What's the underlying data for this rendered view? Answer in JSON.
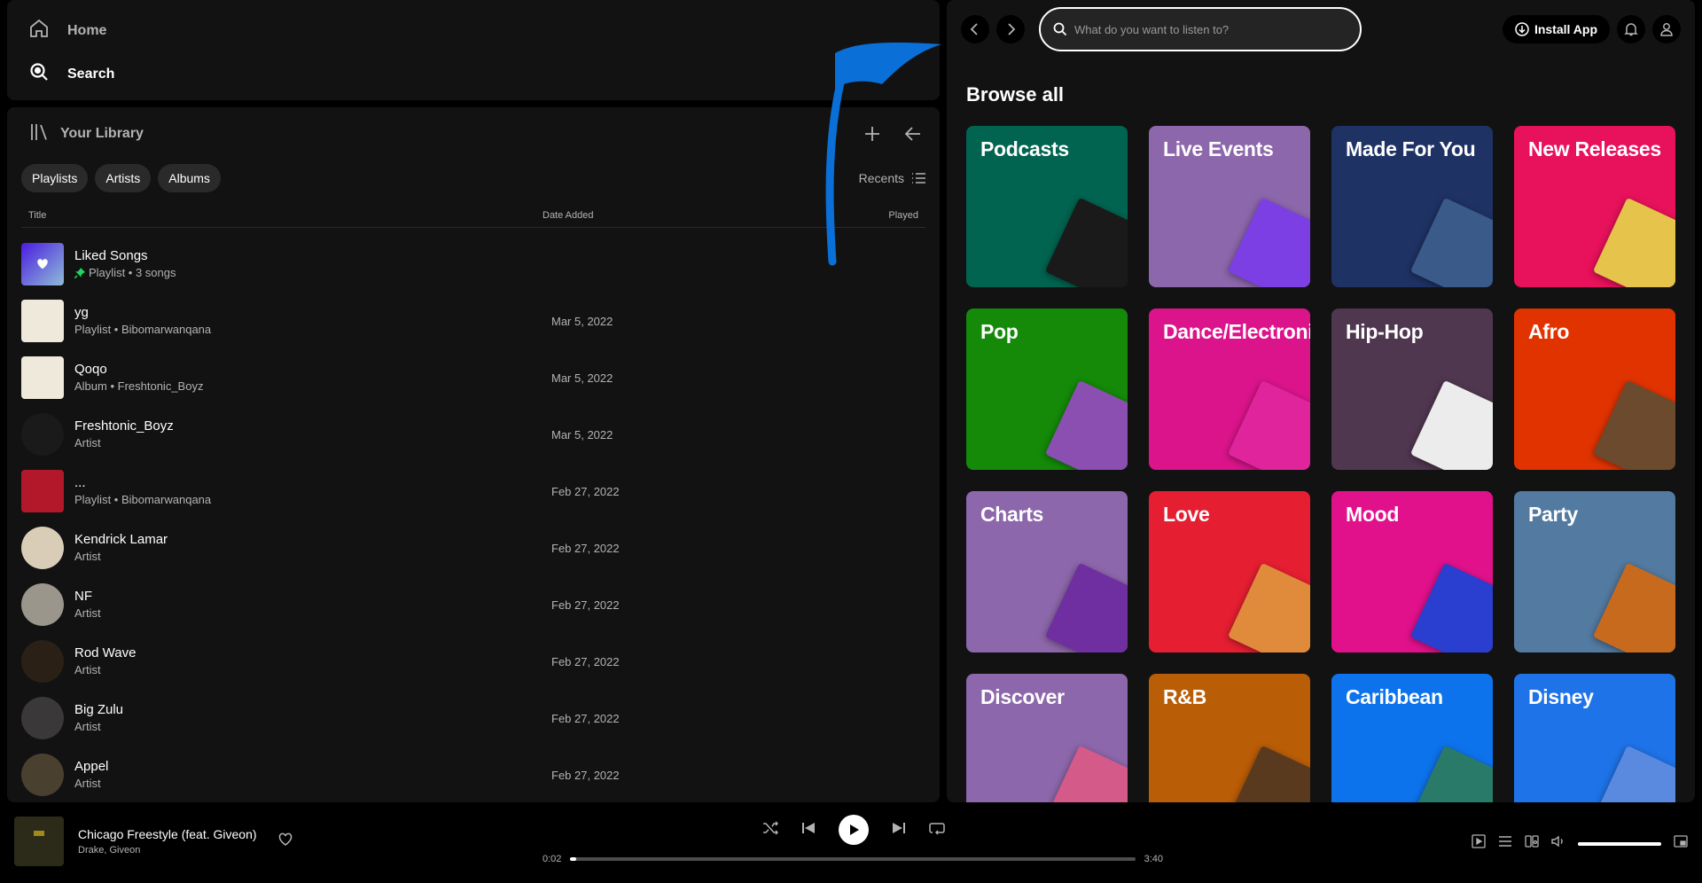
{
  "nav": {
    "home": "Home",
    "search": "Search"
  },
  "library": {
    "title": "Your Library",
    "chips": [
      "Playlists",
      "Artists",
      "Albums"
    ],
    "sort_label": "Recents",
    "columns": {
      "title": "Title",
      "date_added": "Date Added",
      "played": "Played"
    },
    "items": [
      {
        "title": "Liked Songs",
        "subtitle": "Playlist • 3 songs",
        "date": "",
        "pinned": true
      },
      {
        "title": "yg",
        "subtitle": "Playlist • Bibomarwanqana",
        "date": "Mar 5, 2022"
      },
      {
        "title": "Qoqo",
        "subtitle": "Album • Freshtonic_Boyz",
        "date": "Mar 5, 2022"
      },
      {
        "title": "Freshtonic_Boyz",
        "subtitle": "Artist",
        "date": "Mar 5, 2022"
      },
      {
        "title": "...",
        "subtitle": "Playlist • Bibomarwanqana",
        "date": "Feb 27, 2022"
      },
      {
        "title": "Kendrick Lamar",
        "subtitle": "Artist",
        "date": "Feb 27, 2022"
      },
      {
        "title": "NF",
        "subtitle": "Artist",
        "date": "Feb 27, 2022"
      },
      {
        "title": "Rod Wave",
        "subtitle": "Artist",
        "date": "Feb 27, 2022"
      },
      {
        "title": "Big Zulu",
        "subtitle": "Artist",
        "date": "Feb 27, 2022"
      },
      {
        "title": "Appel",
        "subtitle": "Artist",
        "date": "Feb 27, 2022"
      }
    ]
  },
  "topbar": {
    "search_placeholder": "What do you want to listen to?",
    "install_label": "Install App"
  },
  "browse": {
    "title": "Browse all",
    "cards": [
      {
        "title": "Podcasts",
        "color": "#006450",
        "art": "#1a1a1a"
      },
      {
        "title": "Live Events",
        "color": "#8d67ab",
        "art": "#7b3fe4"
      },
      {
        "title": "Made For You",
        "color": "#1e3264",
        "art": "#3a5a8a"
      },
      {
        "title": "New Releases",
        "color": "#e8115b",
        "art": "#e6c34a"
      },
      {
        "title": "Pop",
        "color": "#148a08",
        "art": "#8a4fb0"
      },
      {
        "title": "Dance/Electronic",
        "color": "#dc148c",
        "art": "#e0249c"
      },
      {
        "title": "Hip-Hop",
        "color": "#503750",
        "art": "#ececec"
      },
      {
        "title": "Afro",
        "color": "#e13300",
        "art": "#6b4a2e"
      },
      {
        "title": "Charts",
        "color": "#8d67ab",
        "art": "#6f2fa0"
      },
      {
        "title": "Love",
        "color": "#e61e32",
        "art": "#e08a3c"
      },
      {
        "title": "Mood",
        "color": "#e1118c",
        "art": "#2a3ecf"
      },
      {
        "title": "Party",
        "color": "#537aa1",
        "art": "#c86a1e"
      },
      {
        "title": "Discover",
        "color": "#8d67ab",
        "art": "#d45a8a"
      },
      {
        "title": "R&B",
        "color": "#ba5d07",
        "art": "#5a3a1e"
      },
      {
        "title": "Caribbean",
        "color": "#0d73ec",
        "art": "#2a7a6a"
      },
      {
        "title": "Disney",
        "color": "#1e73e8",
        "art": "#5a8adf"
      }
    ]
  },
  "player": {
    "track": "Chicago Freestyle (feat. Giveon)",
    "artists": "Drake, Giveon",
    "elapsed": "0:02",
    "duration": "3:40",
    "progress": 0.01,
    "volume": 1.0
  },
  "colors": {
    "background": "#000000",
    "panel": "#121212",
    "accent": "#1ed760",
    "annotation": "#0a6fd6"
  }
}
